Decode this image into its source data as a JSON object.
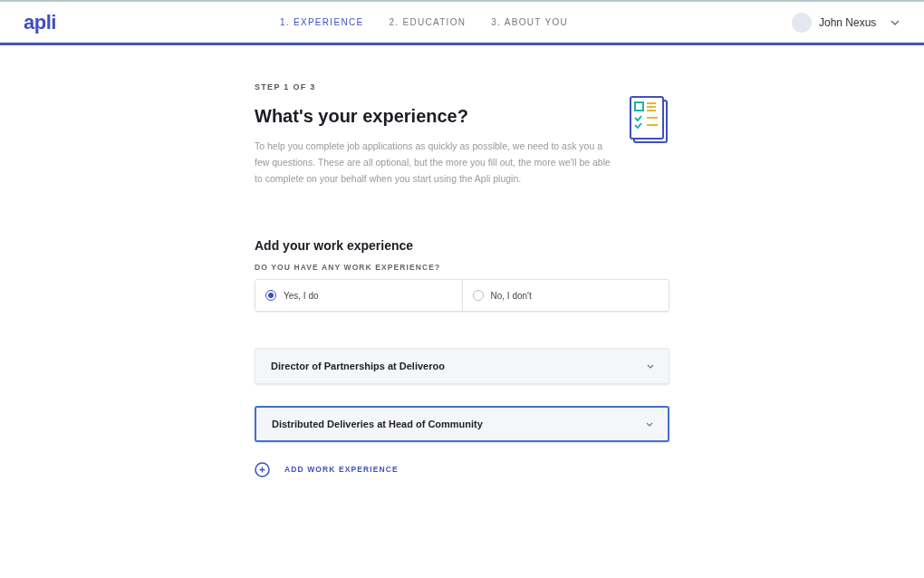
{
  "header": {
    "logo": "apli",
    "steps": [
      {
        "label": "1. EXPERIENCE",
        "selected": true
      },
      {
        "label": "2. EDUCATION",
        "selected": false
      },
      {
        "label": "3. ABOUT YOU",
        "selected": false
      }
    ],
    "user": {
      "name": "John Nexus"
    }
  },
  "step_label": "STEP 1 OF 3",
  "title": "What's your experience?",
  "intro": "To help you complete job applications as quickly as possible, we need to ask you a few questions. These are all optional, but the more you fill out, the more we'll be able to complete on your behalf when you start using the Apli plugin.",
  "section_title": "Add your work experience",
  "question": "DO YOU HAVE ANY WORK EXPERIENCE?",
  "options": [
    {
      "label": "Yes, I do",
      "selected": true
    },
    {
      "label": "No, I don't",
      "selected": false
    }
  ],
  "experiences": [
    {
      "title": "Director of Partnerships at Deliveroo",
      "selected": false
    },
    {
      "title": "Distributed Deliveries at Head of Community",
      "selected": true
    }
  ],
  "add_button": "ADD WORK EXPERIENCE"
}
